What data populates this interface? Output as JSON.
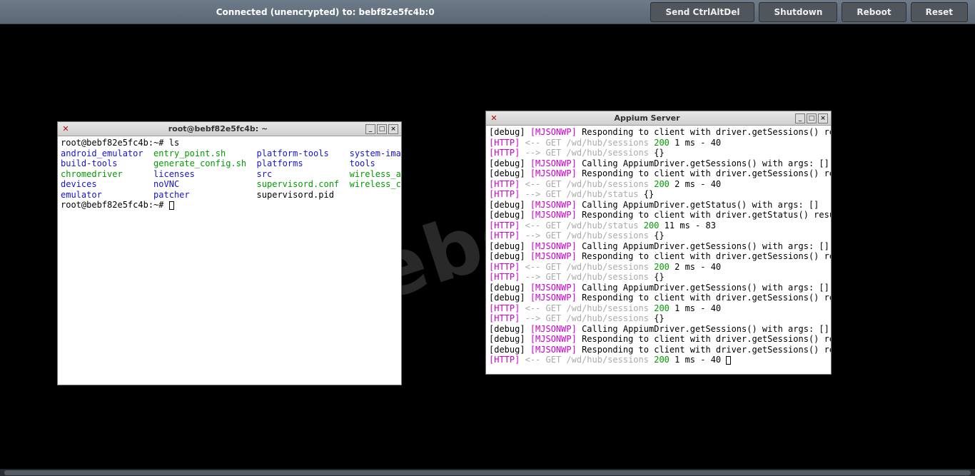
{
  "topbar": {
    "status": "Connected (unencrypted) to: bebf82e5fc4b:0",
    "buttons": {
      "ctrlaltdel": "Send CtrlAltDel",
      "shutdown": "Shutdown",
      "reboot": "Reboot",
      "reset": "Reset"
    }
  },
  "watermark": "codebeamer",
  "terminal": {
    "title": "root@bebf82e5fc4b: ~",
    "prompt1_user": "root@bebf82e5fc4b:~#",
    "prompt1_cmd": "ls",
    "prompt2_user": "root@bebf82e5fc4b:~#",
    "ls": {
      "row1": {
        "c1": "android_emulator",
        "c2": "entry_point.sh",
        "c3": "platform-tools",
        "c4": "system-images"
      },
      "row2": {
        "c1": "build-tools",
        "c2": "generate_config.sh",
        "c3": "platforms",
        "c4": "tools"
      },
      "row3": {
        "c1": "chromedriver",
        "c2": "licenses",
        "c3": "src",
        "c4": "wireless_autoconnect.sh"
      },
      "row4": {
        "c1": "devices",
        "c2": "noVNC",
        "c3": "supervisord.conf",
        "c4": "wireless_connect.sh"
      },
      "row5": {
        "c1": "emulator",
        "c2": "patcher",
        "c3": "supervisord.pid",
        "c4": ""
      }
    }
  },
  "appium": {
    "title": "Appium Server",
    "lines": [
      {
        "t": "dbg",
        "text": "Responding to client with driver.getSessions() result: []"
      },
      {
        "t": "http_in",
        "path": "GET /wd/hub/sessions",
        "code": "200",
        "rest": "1 ms - 40"
      },
      {
        "t": "http_out",
        "path": "GET /wd/hub/sessions",
        "tail": "{}"
      },
      {
        "t": "dbg",
        "text": "Calling AppiumDriver.getSessions() with args: []"
      },
      {
        "t": "dbg",
        "text": "Responding to client with driver.getSessions() result: []"
      },
      {
        "t": "http_in",
        "path": "GET /wd/hub/sessions",
        "code": "200",
        "rest": "2 ms - 40"
      },
      {
        "t": "http_out",
        "path": "GET /wd/hub/status",
        "tail": "{}"
      },
      {
        "t": "dbg",
        "text": "Calling AppiumDriver.getStatus() with args: []"
      },
      {
        "t": "dbg",
        "text": "Responding to client with driver.getStatus() result: {\"build\":{\"version\":\"1.7.1\",\"revision\":null}}"
      },
      {
        "t": "http_in",
        "path": "GET /wd/hub/status",
        "code": "200",
        "rest": "11 ms - 83"
      },
      {
        "t": "http_out",
        "path": "GET /wd/hub/sessions",
        "tail": "{}"
      },
      {
        "t": "dbg",
        "text": "Calling AppiumDriver.getSessions() with args: []"
      },
      {
        "t": "dbg",
        "text": "Responding to client with driver.getSessions() result: []"
      },
      {
        "t": "http_in",
        "path": "GET /wd/hub/sessions",
        "code": "200",
        "rest": "2 ms - 40"
      },
      {
        "t": "http_out",
        "path": "GET /wd/hub/sessions",
        "tail": "{}"
      },
      {
        "t": "dbg",
        "text": "Calling AppiumDriver.getSessions() with args: []"
      },
      {
        "t": "dbg",
        "text": "Responding to client with driver.getSessions() result: []"
      },
      {
        "t": "http_in",
        "path": "GET /wd/hub/sessions",
        "code": "200",
        "rest": "1 ms - 40"
      },
      {
        "t": "http_out",
        "path": "GET /wd/hub/sessions",
        "tail": "{}"
      },
      {
        "t": "dbg",
        "text": "Calling AppiumDriver.getSessions() with args: []"
      },
      {
        "t": "dbg",
        "text": "Responding to client with driver.getSessions() result: []"
      },
      {
        "t": "dbg",
        "text": "Responding to client with driver.getSessions() result: []"
      },
      {
        "t": "http_in",
        "path": "GET /wd/hub/sessions",
        "code": "200",
        "rest": "1 ms - 40",
        "cursor": true
      }
    ],
    "tags": {
      "http": "[HTTP]",
      "debug": "[debug]",
      "mjsonwp": "[MJSONWP]",
      "arrow_in": "<--",
      "arrow_out": "-->"
    }
  }
}
